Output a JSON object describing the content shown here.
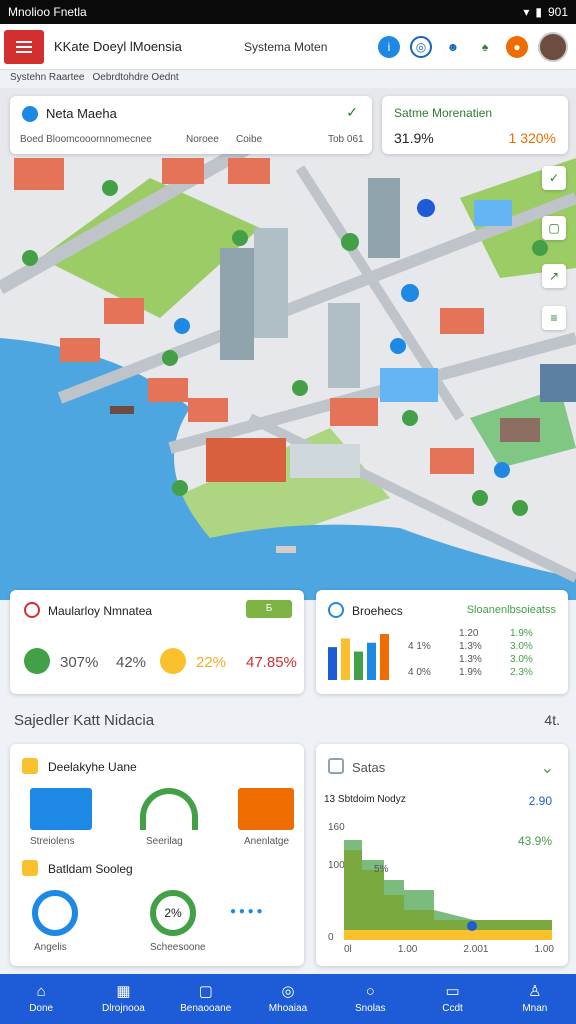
{
  "status": {
    "title": "Mnolioo Fnetla",
    "time": "901"
  },
  "appbar": {
    "title": "KKate Doeyl lMoensia",
    "system": "Systema Moten"
  },
  "crumbs": [
    "Systehn Raartee",
    "Oebrdtohdre Oednt"
  ],
  "map_card": {
    "title": "Neta Maeha",
    "col1": "Boed Bloomcooornnomecnee",
    "col2": "Noroee",
    "col3": "Coibe",
    "col4": "Tob 061"
  },
  "stat_card": {
    "title": "Satme Morenatien",
    "left": "31.9%",
    "right": "1 320%"
  },
  "card_a": {
    "title": "Maularloy Nmnatea",
    "badge": "Б",
    "v1": "307%",
    "v2": "42%",
    "v3": "22%",
    "v4": "47.85%"
  },
  "card_b": {
    "title": "Broehecs",
    "sub": "Sloanenlbsoieatss",
    "rows": [
      [
        "",
        "1.20",
        "1.9%"
      ],
      [
        "4 1%",
        "1.3%",
        "3.0%"
      ],
      [
        "",
        "1.3%",
        "3.0%"
      ],
      [
        "4 0%",
        "1.9%",
        "2.3%"
      ]
    ],
    "bars": [
      30,
      38,
      26,
      34,
      42
    ]
  },
  "section": {
    "title": "Sajedler Katt Nidacia",
    "count": "4t."
  },
  "card_c": {
    "title": "Deelakyhe Uane",
    "items": [
      "Streiolens",
      "Seerilag",
      "Anenlatge"
    ],
    "sub": "Batldam Sooleg",
    "ring1": "Angelis",
    "ring2": "Scheesoone",
    "ring2_val": "2%"
  },
  "card_d": {
    "title": "Satas",
    "label": "13 Sbtdoim Nodyz",
    "v1": "2.90",
    "v2": "43.9%",
    "y_top": "160",
    "y_mid": "100",
    "y_bot": "0",
    "x_ticks": [
      "0l",
      "1.00",
      "2.001",
      "1.00"
    ],
    "mid_note": "5%"
  },
  "nav": [
    "Done",
    "Dlrojnooa",
    "Benaooane",
    "Mhoaiaa",
    "Snolas",
    "Ccdt",
    "Mnan"
  ],
  "colors": {
    "accent": "#1e5bd6",
    "red": "#d32f2f",
    "green": "#43a047"
  }
}
